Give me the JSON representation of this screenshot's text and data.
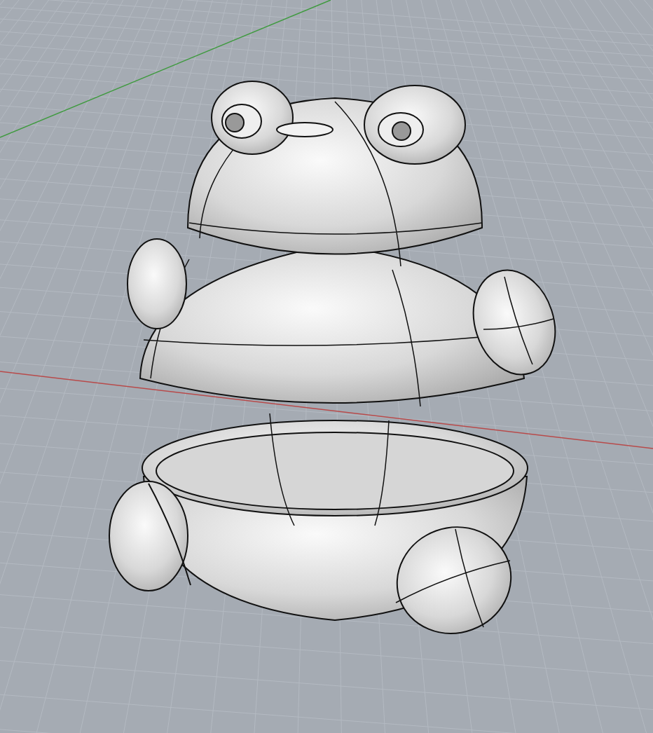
{
  "viewport": {
    "axes": [
      {
        "kind": "x",
        "color": "#b84a4a"
      },
      {
        "kind": "y",
        "color": "#3f9a3f"
      }
    ]
  }
}
